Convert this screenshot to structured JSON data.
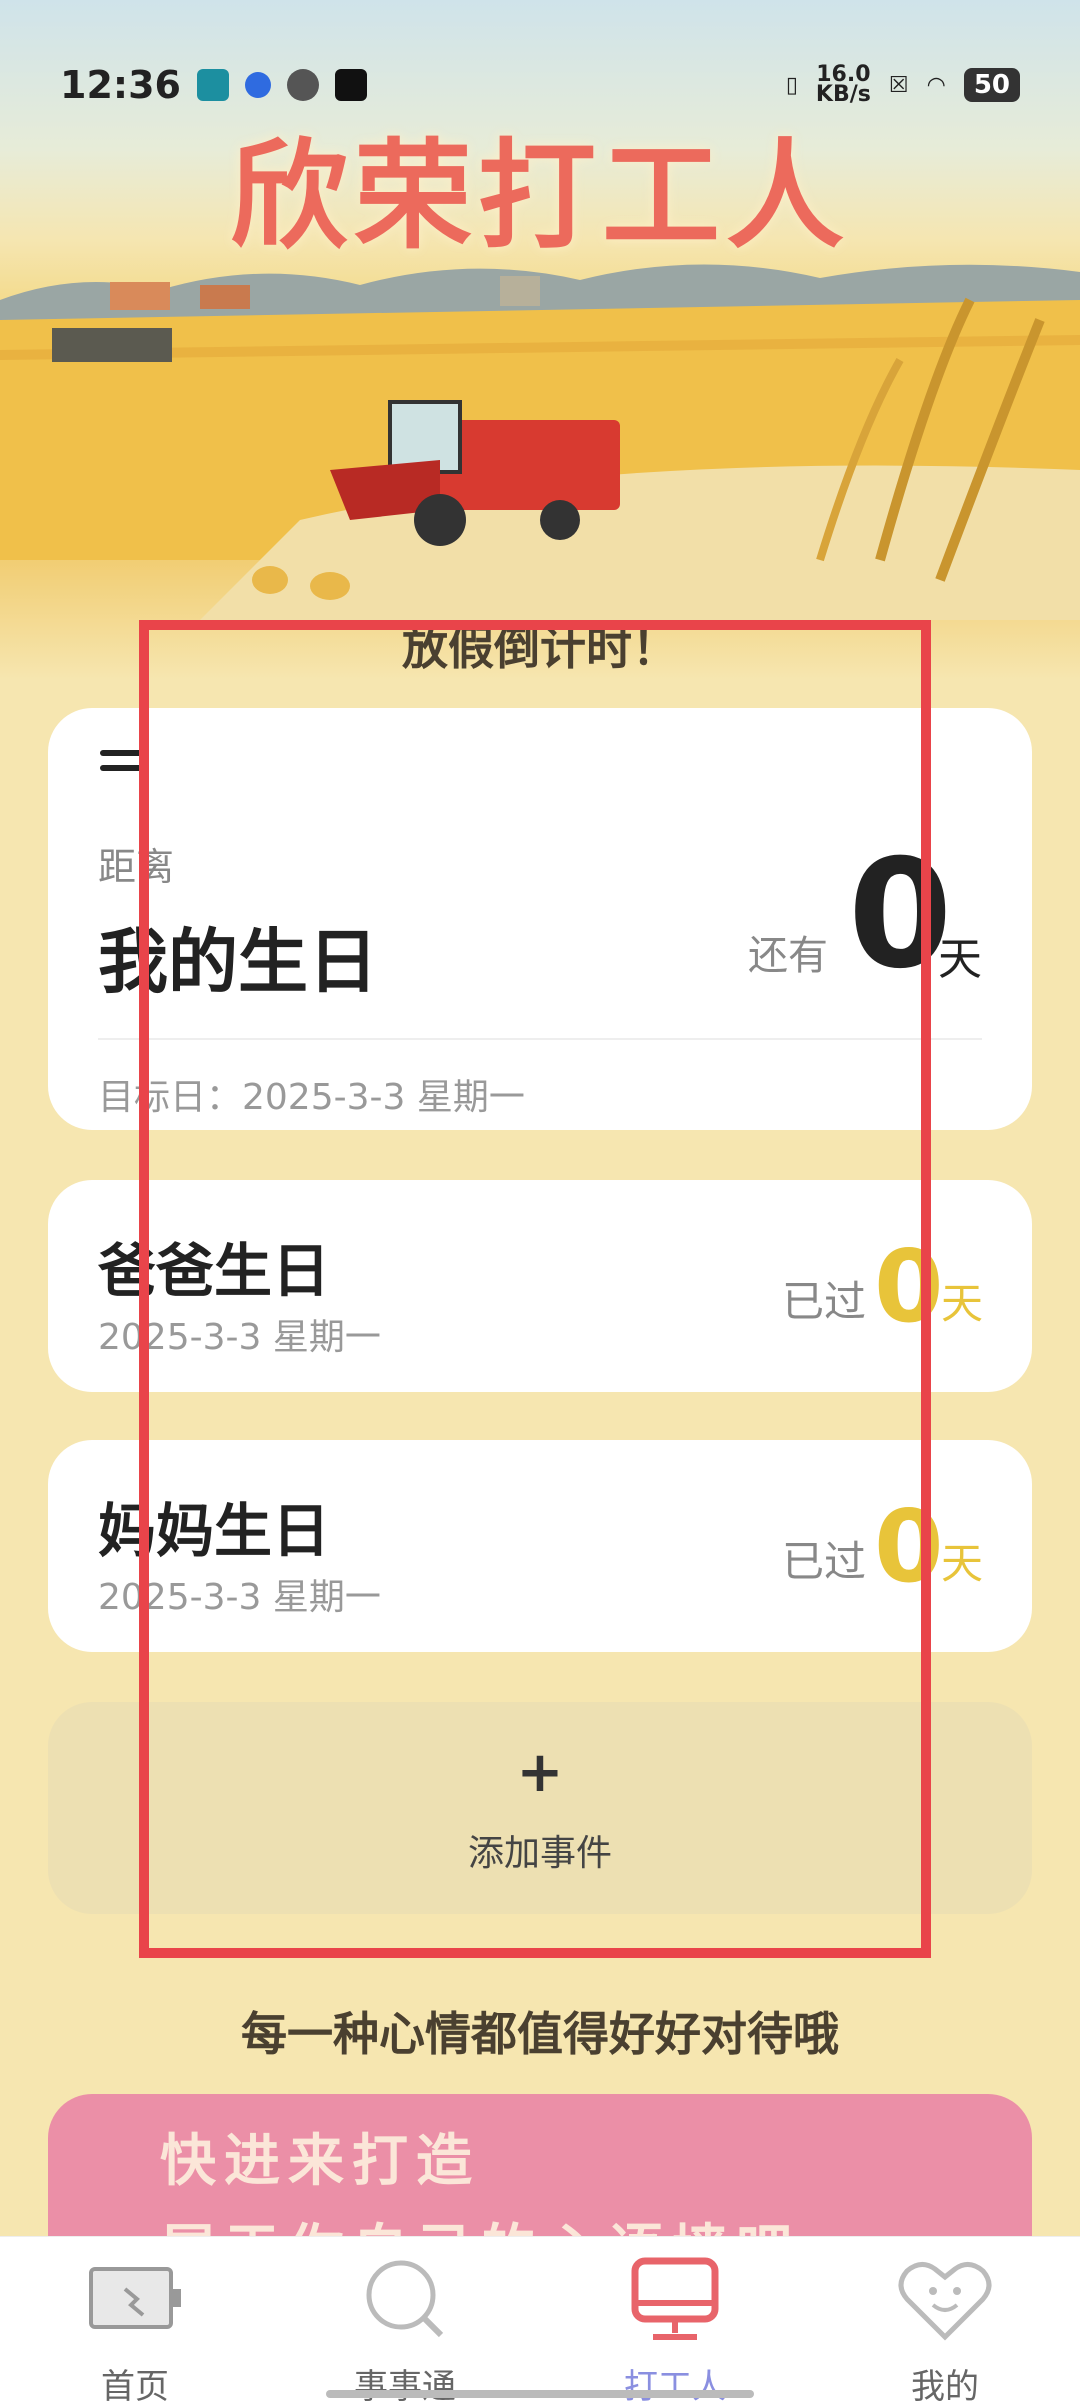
{
  "status_bar": {
    "time": "12:36",
    "speed_top": "16.0",
    "speed_bottom": "KB/s",
    "battery": "50"
  },
  "app_title": "欣荣打工人",
  "section_title": "放假倒计时！",
  "main_card": {
    "label": "距离",
    "event_name": "我的生日",
    "remain_label": "还有",
    "remain_days": "0",
    "unit": "天",
    "target_date": "目标日：2025-3-3 星期一"
  },
  "events": [
    {
      "name": "爸爸生日",
      "date": "2025-3-3 星期一",
      "passed_label": "已过",
      "days": "0",
      "unit": "天"
    },
    {
      "name": "妈妈生日",
      "date": "2025-3-3 星期一",
      "passed_label": "已过",
      "days": "0",
      "unit": "天"
    }
  ],
  "add_event": {
    "plus": "+",
    "label": "添加事件"
  },
  "slogan": "每一种心情都值得好好对待哦",
  "banner": {
    "line1": "快进来打造",
    "line2": "属于你自己的心语墙吧"
  },
  "bottom_nav": [
    {
      "label": "首页",
      "icon": "battery-screen-icon",
      "active": false
    },
    {
      "label": "事事通",
      "icon": "search-icon",
      "active": false
    },
    {
      "label": "打工人",
      "icon": "monitor-icon",
      "active": true
    },
    {
      "label": "我的",
      "icon": "heart-face-icon",
      "active": false
    }
  ],
  "colors": {
    "title": "#ec6a5c",
    "accent_yellow": "#e8c43a",
    "nav_active": "#8a8fe0",
    "highlight": "#e9444a",
    "background": "#f6e6b0"
  }
}
